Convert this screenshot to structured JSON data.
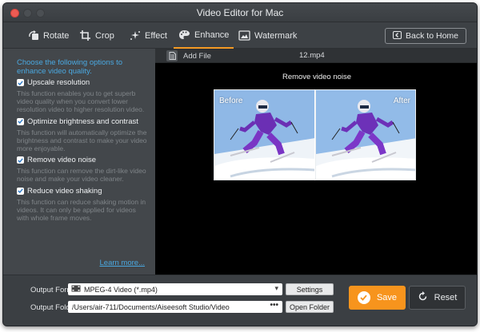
{
  "window": {
    "title": "Video Editor for Mac"
  },
  "toolbar": {
    "tabs": [
      {
        "label": "Rotate",
        "icon": "rotate-icon"
      },
      {
        "label": "Crop",
        "icon": "crop-icon"
      },
      {
        "label": "Effect",
        "icon": "effect-icon"
      },
      {
        "label": "Enhance",
        "icon": "enhance-icon",
        "active": true
      },
      {
        "label": "Watermark",
        "icon": "watermark-icon"
      }
    ],
    "home_label": "Back to Home"
  },
  "enhance": {
    "intro": "Choose the following options to enhance video quality.",
    "options": [
      {
        "label": "Upscale resolution",
        "checked": true,
        "description": "This function enables you to get superb video quality when you convert lower resolution video to higher resolution video."
      },
      {
        "label": "Optimize brightness and contrast",
        "checked": true,
        "description": "This function will automatically optimize the brightness and contrast to make your video more enjoyable."
      },
      {
        "label": "Remove video noise",
        "checked": true,
        "description": "This function can remove the dirt-like video noise and make your video cleaner."
      },
      {
        "label": "Reduce video shaking",
        "checked": true,
        "description": "This function can reduce shaking motion in videos. It can only be applied for videos with whole frame moves."
      }
    ],
    "learn_more": "Learn more..."
  },
  "preview": {
    "add_file": "Add File",
    "filename": "12.mp4",
    "caption": "Remove video noise",
    "before_label": "Before",
    "after_label": "After"
  },
  "output": {
    "format_label": "Output Format:",
    "format_value": "MPEG-4 Video (*.mp4)",
    "settings_label": "Settings",
    "folder_label": "Output Folder:",
    "folder_value": "/Users/air-711/Documents/Aiseesoft Studio/Video",
    "folder_dots": "•••",
    "open_folder_label": "Open Folder",
    "save_label": "Save",
    "reset_label": "Reset"
  },
  "colors": {
    "accent": "#f7941d",
    "link": "#4aa8e0",
    "panel": "#43474b",
    "background": "#3b3f43"
  }
}
